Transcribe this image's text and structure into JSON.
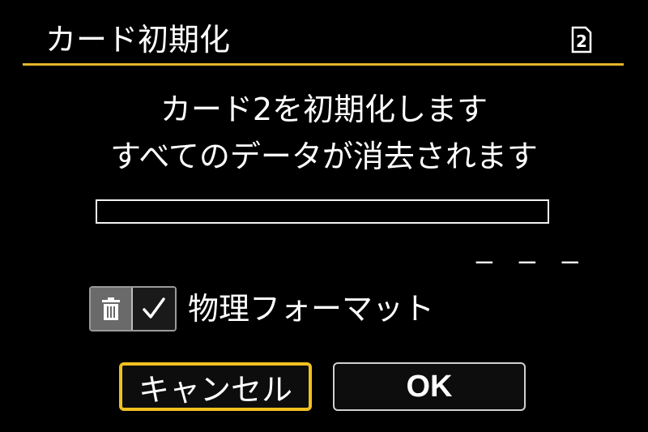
{
  "header": {
    "title": "カード初期化",
    "card_indicator": "2",
    "card_icon": "card-slot-icon"
  },
  "message": {
    "line1": "カード2を初期化します",
    "line2": "すべてのデータが消去されます"
  },
  "progress": {
    "fraction": 0.0,
    "remaining_text": "– – –"
  },
  "option": {
    "icon": "trash-icon",
    "checked": true,
    "label": "物理フォーマット"
  },
  "buttons": {
    "cancel_label": "キャンセル",
    "ok_label": "OK"
  },
  "colors": {
    "accent": "#e5b52a",
    "focus": "#f0c020",
    "background": "#000000",
    "text": "#ffffff"
  }
}
